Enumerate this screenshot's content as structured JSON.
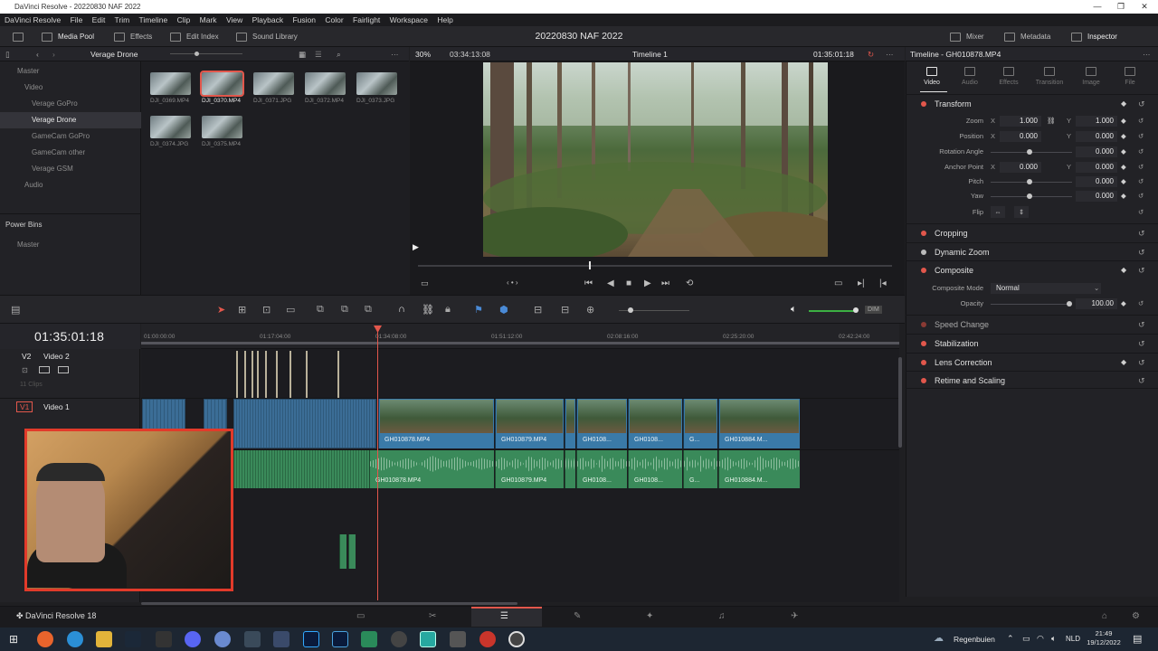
{
  "window": {
    "title": "DaVinci Resolve - 20220830 NAF 2022",
    "controls": [
      "—",
      "❐",
      "✕"
    ]
  },
  "menu": [
    "DaVinci Resolve",
    "File",
    "Edit",
    "Trim",
    "Timeline",
    "Clip",
    "Mark",
    "View",
    "Playback",
    "Fusion",
    "Color",
    "Fairlight",
    "Workspace",
    "Help"
  ],
  "toolbar": {
    "media_pool": "Media Pool",
    "effects": "Effects",
    "edit_index": "Edit Index",
    "sound_library": "Sound Library",
    "project_title": "20220830 NAF 2022",
    "mixer": "Mixer",
    "metadata": "Metadata",
    "inspector": "Inspector"
  },
  "media_pool": {
    "current_bin": "Verage Drone",
    "bins": [
      {
        "label": "Master"
      },
      {
        "label": "Video"
      },
      {
        "label": "Verage GoPro"
      },
      {
        "label": "Verage Drone"
      },
      {
        "label": "GameCam GoPro"
      },
      {
        "label": "GameCam other"
      },
      {
        "label": "Verage GSM"
      },
      {
        "label": "Audio"
      }
    ],
    "power_bins": "Power Bins",
    "power_master": "Master",
    "clips": [
      "DJI_0369.MP4",
      "DJI_0370.MP4",
      "DJI_0371.JPG",
      "DJI_0372.MP4",
      "DJI_0373.JPG",
      "DJI_0374.JPG",
      "DJI_0375.MP4"
    ],
    "selected_clip": "DJI_0370.MP4"
  },
  "viewer": {
    "zoom": "30%",
    "source_duration": "03:34:13:08",
    "timeline_name": "Timeline 1",
    "timecode": "01:35:01:18",
    "scrub_fraction": 0.36
  },
  "inspector": {
    "title": "Timeline - GH010878.MP4",
    "tabs": [
      "Video",
      "Audio",
      "Effects",
      "Transition",
      "Image",
      "File"
    ],
    "active_tab": "Video",
    "transform": {
      "label": "Transform",
      "zoom_label": "Zoom",
      "zoom_x": "1.000",
      "zoom_y": "1.000",
      "position_label": "Position",
      "position_x": "0.000",
      "position_y": "0.000",
      "rotation_label": "Rotation Angle",
      "rotation": "0.000",
      "anchor_label": "Anchor Point",
      "anchor_x": "0.000",
      "anchor_y": "0.000",
      "pitch_label": "Pitch",
      "pitch": "0.000",
      "yaw_label": "Yaw",
      "yaw": "0.000",
      "flip_label": "Flip",
      "axis_x": "X",
      "axis_y": "Y"
    },
    "sections": {
      "cropping": "Cropping",
      "dynamic_zoom": "Dynamic Zoom",
      "composite": "Composite",
      "composite_mode_label": "Composite Mode",
      "composite_mode": "Normal",
      "opacity_label": "Opacity",
      "opacity": "100.00",
      "speed_change": "Speed Change",
      "stabilization": "Stabilization",
      "lens_correction": "Lens Correction",
      "retime_scaling": "Retime and Scaling"
    }
  },
  "timeline": {
    "timecode": "01:35:01:18",
    "ruler": [
      "01:00:00:00",
      "01:17:04:00",
      "01:34:08:00",
      "01:51:12:00",
      "02:08:16:00",
      "02:25:20:00",
      "02:42:24:00"
    ],
    "tracks": {
      "v2": {
        "id": "V2",
        "name": "Video 2",
        "count": "11 Clips"
      },
      "v1": {
        "id": "V1",
        "name": "Video 1"
      }
    },
    "video_clips": [
      "GH010878.MP4",
      "GH010879.MP4",
      "GH0108...",
      "GH0108...",
      "G...",
      "GH010884.M..."
    ],
    "audio_clips": [
      "GH010878.MP4",
      "GH010879.MP4",
      "GH0108...",
      "GH0108...",
      "G...",
      "GH010884.M..."
    ]
  },
  "pagebar": {
    "app": "DaVinci Resolve 18"
  },
  "taskbar": {
    "weather": "Regenbuien",
    "lang": "NLD",
    "time": "21:49",
    "date": "19/12/2022"
  },
  "colors": {
    "accent": "#e2574c",
    "video_clip": "#3a7aa8",
    "audio_clip": "#3a8a5a",
    "panel": "#222226"
  }
}
